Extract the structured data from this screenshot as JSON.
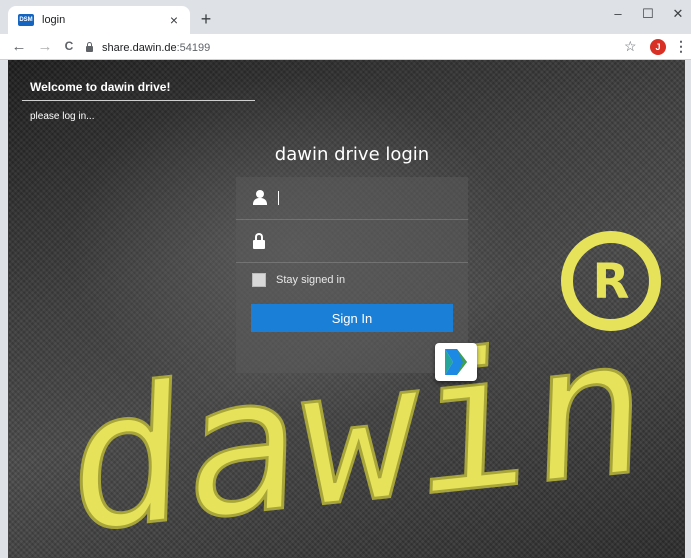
{
  "browser": {
    "tab": {
      "favicon_text": "DSM",
      "title": "login",
      "close_glyph": "×"
    },
    "new_tab_glyph": "+",
    "window_controls": {
      "minimize": "–",
      "maximize": "☐",
      "close": "✕"
    },
    "nav": {
      "back": "←",
      "forward": "→",
      "reload": "C"
    },
    "address": {
      "host": "share.dawin.de",
      "port": ":54199"
    },
    "star_glyph": "☆",
    "profile_initial": "J",
    "menu_glyph": "⋮"
  },
  "page": {
    "welcome": "Welcome to dawin drive!",
    "please": "please log in...",
    "login_title": "dawin drive login",
    "username": {
      "value": "",
      "placeholder": ""
    },
    "password": {
      "value": "",
      "placeholder": ""
    },
    "remember_label": "Stay signed in",
    "signin_label": "Sign In",
    "background_logo": {
      "text": "dawin",
      "registered": "R"
    }
  },
  "colors": {
    "accent": "#1a7fd6",
    "logo_yellow": "#e6e35a",
    "profile": "#d93025"
  }
}
